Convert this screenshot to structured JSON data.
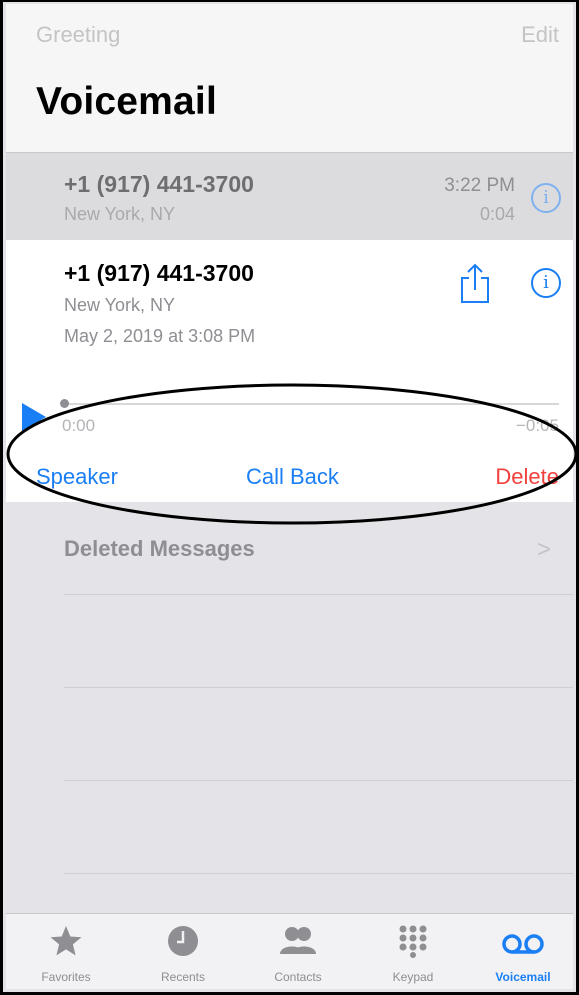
{
  "header": {
    "greeting": "Greeting",
    "edit": "Edit",
    "title": "Voicemail"
  },
  "voicemails": [
    {
      "number": "+1 (917) 441-3700",
      "location": "New York, NY",
      "time": "3:22 PM",
      "duration": "0:04"
    }
  ],
  "expanded": {
    "number": "+1 (917) 441-3700",
    "location": "New York, NY",
    "date": "May 2, 2019 at 3:08 PM",
    "elapsed": "0:00",
    "remaining": "−0:05",
    "progress": 0,
    "actions": {
      "speaker": "Speaker",
      "call_back": "Call Back",
      "delete": "Delete"
    }
  },
  "deleted_messages": {
    "label": "Deleted Messages",
    "chevron": ">"
  },
  "tabs": [
    {
      "label": "Favorites",
      "icon": "star-icon"
    },
    {
      "label": "Recents",
      "icon": "clock-icon"
    },
    {
      "label": "Contacts",
      "icon": "contacts-icon"
    },
    {
      "label": "Keypad",
      "icon": "keypad-icon"
    },
    {
      "label": "Voicemail",
      "icon": "voicemail-icon",
      "active": true
    }
  ],
  "colors": {
    "accent": "#1a7ff5",
    "destructive": "#f0413c",
    "inactive": "#8e8e93"
  }
}
